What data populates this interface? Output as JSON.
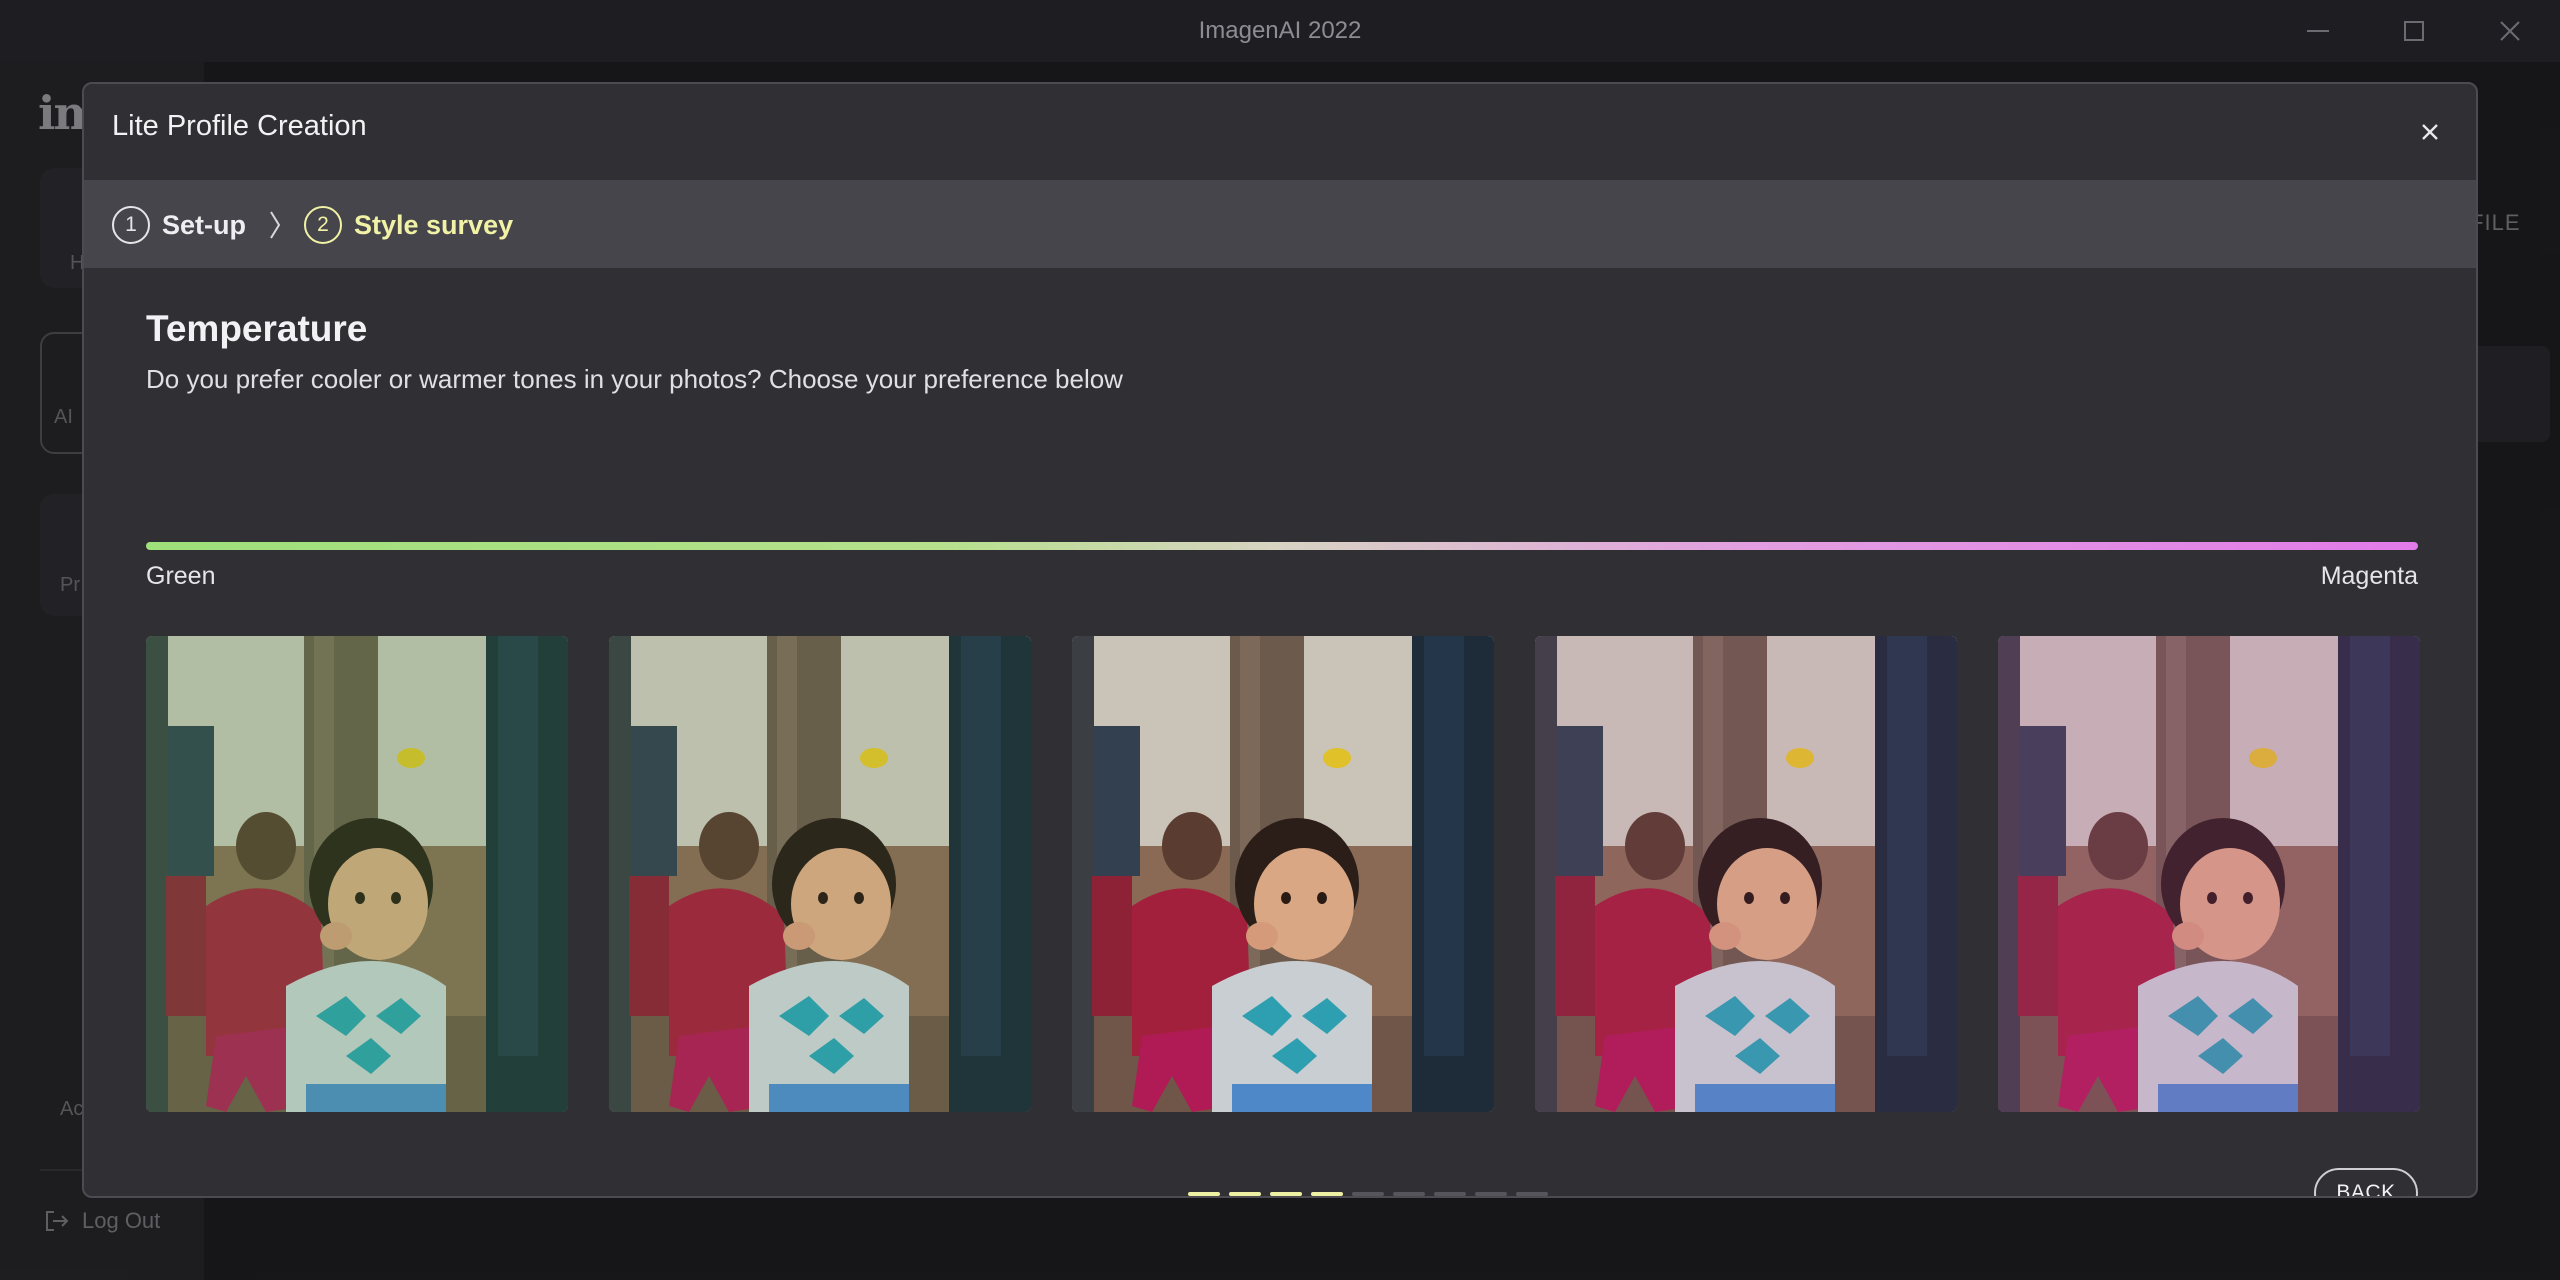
{
  "window": {
    "title": "ImagenAI 2022"
  },
  "background": {
    "logo_text": "im",
    "sidebar_texts": [
      "H",
      "AI",
      "Pr",
      "Ac"
    ],
    "logout_label": "Log Out",
    "right_text": "OFILE"
  },
  "modal": {
    "title": "Lite Profile Creation",
    "steps": [
      {
        "number": "1",
        "label": "Set-up"
      },
      {
        "number": "2",
        "label": "Style survey"
      }
    ],
    "question": {
      "title": "Temperature",
      "description": "Do you prefer cooler or warmer tones in your photos? Choose your preference below"
    },
    "scale": {
      "left_label": "Green",
      "right_label": "Magenta",
      "colors": {
        "left": "#9ee07a",
        "right": "#e27be8"
      }
    },
    "photos": [
      {
        "tint": "green"
      },
      {
        "tint": "slight-green"
      },
      {
        "tint": "neutral"
      },
      {
        "tint": "slight-magenta"
      },
      {
        "tint": "magenta"
      }
    ],
    "progress": {
      "completed": 4,
      "total": 9
    },
    "back_label": "BACK"
  },
  "colors": {
    "accent": "#f1f2a6",
    "modal_bg": "#2f2f34",
    "stepper_bg": "#45454b"
  }
}
